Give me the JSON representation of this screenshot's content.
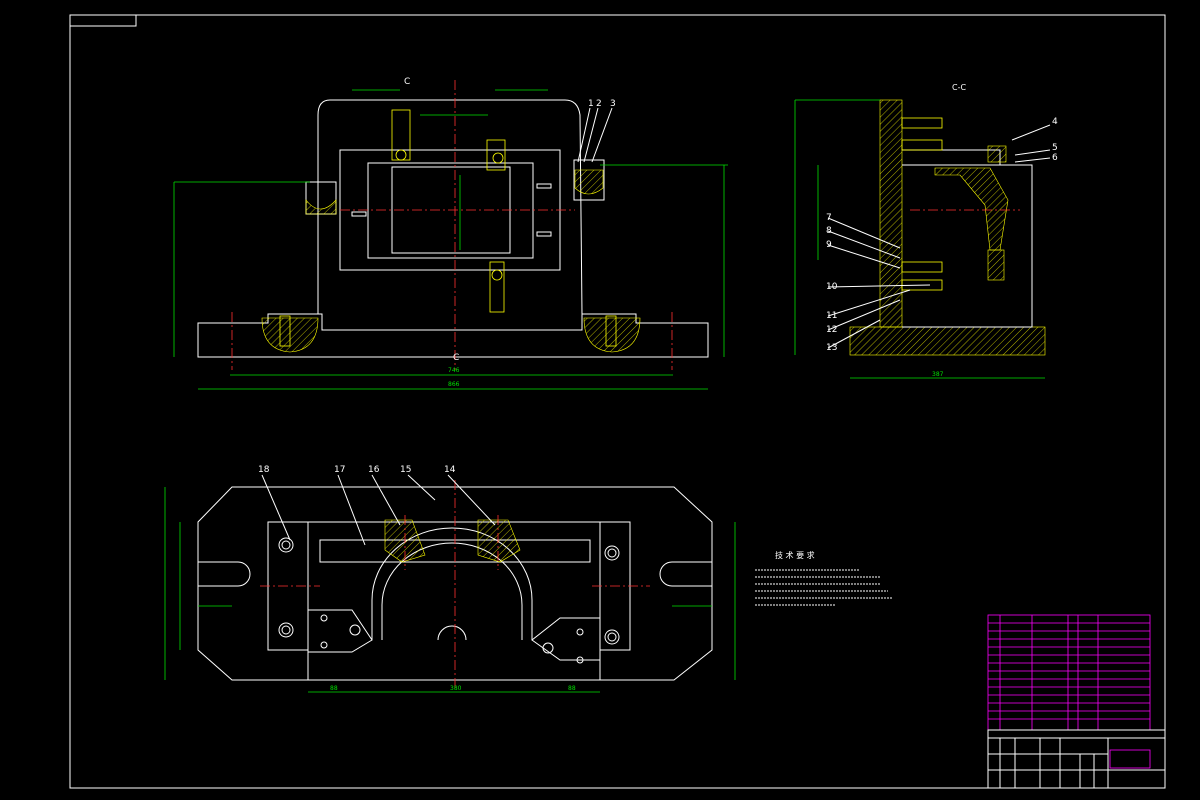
{
  "drawing": {
    "section_label": "C-C",
    "section_marks": [
      "C",
      "C"
    ],
    "front_dims": [
      "746",
      "866"
    ],
    "side_dims": [
      "387"
    ],
    "plan_dims": [
      "88",
      "380",
      "88"
    ],
    "balloons_front": [
      "1",
      "2",
      "3"
    ],
    "balloons_side": [
      "4",
      "5",
      "6",
      "7",
      "8",
      "9",
      "10",
      "11",
      "12",
      "13"
    ],
    "balloons_plan": [
      "18",
      "17",
      "16",
      "15",
      "14"
    ],
    "notes_title": "技 术 要 求"
  }
}
